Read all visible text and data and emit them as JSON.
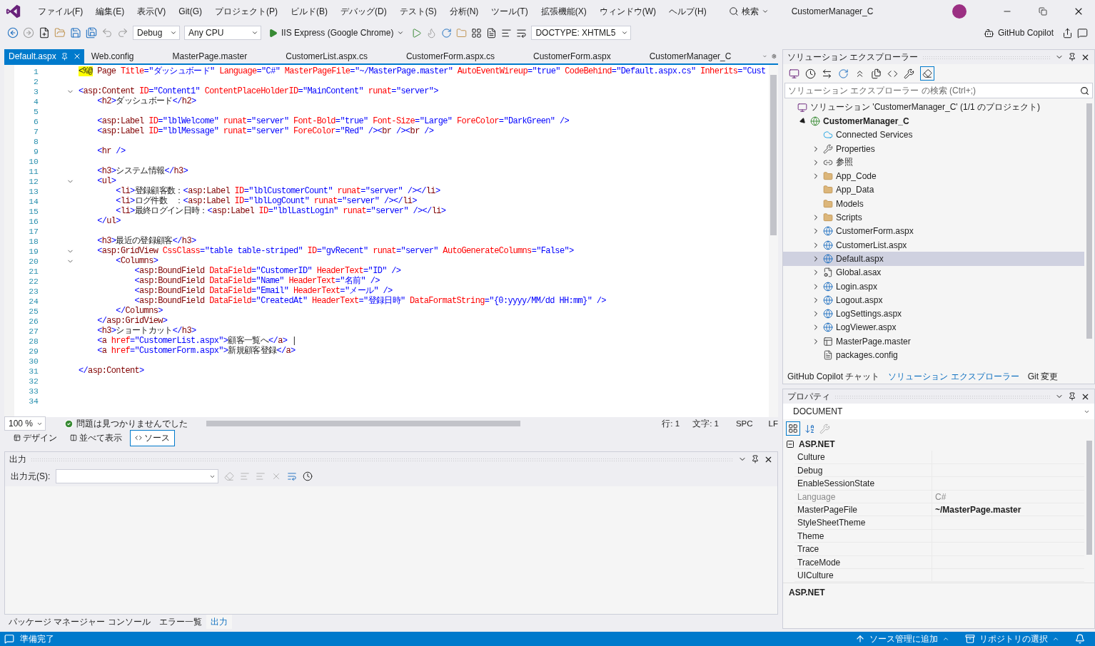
{
  "menu": [
    "ファイル(F)",
    "編集(E)",
    "表示(V)",
    "Git(G)",
    "プロジェクト(P)",
    "ビルド(B)",
    "デバッグ(D)",
    "テスト(S)",
    "分析(N)",
    "ツール(T)",
    "拡張機能(X)",
    "ウィンドウ(W)",
    "ヘルプ(H)"
  ],
  "search": "検索",
  "window_title": "CustomerManager_C",
  "toolbar": {
    "configuration": "Debug",
    "platform": "Any CPU",
    "run_target": "IIS Express (Google Chrome)",
    "doctype": "DOCTYPE: XHTML5",
    "copilot": "GitHub Copilot"
  },
  "editor_tabs": [
    {
      "label": "Default.aspx",
      "selected": true
    },
    {
      "label": "Web.config",
      "selected": false
    },
    {
      "label": "MasterPage.master",
      "selected": false
    },
    {
      "label": "CustomerList.aspx.cs",
      "selected": false
    },
    {
      "label": "CustomerForm.aspx.cs",
      "selected": false
    },
    {
      "label": "CustomerForm.aspx",
      "selected": false
    },
    {
      "label": "CustomerManager_C",
      "selected": false
    }
  ],
  "code_lines": [
    {
      "number": "1",
      "foldable": false,
      "code": "<%@ Page Title=\"ダッシュボード\" Language=\"C#\" MasterPageFile=\"~/MasterPage.master\" AutoEventWireup=\"true\" CodeBehind=\"Default.aspx.cs\" Inherits=\"Cust"
    },
    {
      "number": "2",
      "foldable": false
    },
    {
      "number": "3",
      "foldable": true,
      "code": "<asp:Content ID=\"Content1\" ContentPlaceHolderID=\"MainContent\" runat=\"server\">"
    },
    {
      "number": "4",
      "foldable": false,
      "code": "    <h2>ダッシュボード</h2>"
    },
    {
      "number": "5",
      "foldable": false
    },
    {
      "number": "6",
      "foldable": false,
      "code": "    <asp:Label ID=\"lblWelcome\" runat=\"server\" Font-Bold=\"true\" Font-Size=\"Large\" ForeColor=\"DarkGreen\" />"
    },
    {
      "number": "7",
      "foldable": false,
      "code": "    <asp:Label ID=\"lblMessage\" runat=\"server\" ForeColor=\"Red\" /><br /><br />"
    },
    {
      "number": "8",
      "foldable": false
    },
    {
      "number": "9",
      "foldable": false,
      "code": "    <hr />"
    },
    {
      "number": "10",
      "foldable": false
    },
    {
      "number": "11",
      "foldable": false,
      "code": "    <h3>システム情報</h3>"
    },
    {
      "number": "12",
      "foldable": true,
      "code": "    <ul>"
    },
    {
      "number": "13",
      "foldable": false,
      "code": "        <li>登録顧客数：<asp:Label ID=\"lblCustomerCount\" runat=\"server\" /></li>"
    },
    {
      "number": "14",
      "foldable": false,
      "code": "        <li>ログ件数　：<asp:Label ID=\"lblLogCount\" runat=\"server\" /></li>"
    },
    {
      "number": "15",
      "foldable": false,
      "code": "        <li>最終ログイン日時：<asp:Label ID=\"lblLastLogin\" runat=\"server\" /></li>"
    },
    {
      "number": "16",
      "foldable": false,
      "code": "    </ul>"
    },
    {
      "number": "17",
      "foldable": false
    },
    {
      "number": "18",
      "foldable": false,
      "code": "    <h3>最近の登録顧客</h3>"
    },
    {
      "number": "19",
      "foldable": true,
      "code": "    <asp:GridView CssClass=\"table table-striped\" ID=\"gvRecent\" runat=\"server\" AutoGenerateColumns=\"False\">"
    },
    {
      "number": "20",
      "foldable": true,
      "code": "        <Columns>"
    },
    {
      "number": "21",
      "foldable": false,
      "code": "            <asp:BoundField DataField=\"CustomerID\" HeaderText=\"ID\" />"
    },
    {
      "number": "22",
      "foldable": false,
      "code": "            <asp:BoundField DataField=\"Name\" HeaderText=\"名前\" />"
    },
    {
      "number": "23",
      "foldable": false,
      "code": "            <asp:BoundField DataField=\"Email\" HeaderText=\"メール\" />"
    },
    {
      "number": "24",
      "foldable": false,
      "code": "            <asp:BoundField DataField=\"CreatedAt\" HeaderText=\"登録日時\" DataFormatString=\"{0:yyyy/MM/dd HH:mm}\" />"
    },
    {
      "number": "25",
      "foldable": false,
      "code": "        </Columns>"
    },
    {
      "number": "26",
      "foldable": false,
      "code": "    </asp:GridView>"
    },
    {
      "number": "27",
      "foldable": false,
      "code": "    <h3>ショートカット</h3>"
    },
    {
      "number": "28",
      "foldable": false,
      "code": "    <a href=\"CustomerList.aspx\">顧客一覧へ</a> |"
    },
    {
      "number": "29",
      "foldable": false,
      "code": "    <a href=\"CustomerForm.aspx\">新規顧客登録</a>"
    },
    {
      "number": "30",
      "foldable": false
    },
    {
      "number": "31",
      "foldable": false,
      "code": "</asp:Content>"
    },
    {
      "number": "32",
      "foldable": false
    },
    {
      "number": "33",
      "foldable": false
    },
    {
      "number": "34",
      "foldable": false
    }
  ],
  "editor_status": {
    "zoom": "100 %",
    "issues": "問題は見つかりませんでした",
    "line": "行: 1",
    "column": "文字: 1",
    "whitespace": "SPC",
    "line_ending": "LF"
  },
  "view_tabs": [
    {
      "label": "デザイン",
      "kind": "design",
      "selected": false
    },
    {
      "label": "並べて表示",
      "kind": "split",
      "selected": false
    },
    {
      "label": "ソース",
      "kind": "source",
      "selected": true
    }
  ],
  "output": {
    "title": "出力",
    "source_label": "出力元(S):"
  },
  "bottom_tabs": [
    {
      "label": "パッケージ マネージャー コンソール",
      "selected": false
    },
    {
      "label": "エラー一覧",
      "selected": false
    },
    {
      "label": "出力",
      "selected": true
    }
  ],
  "solution_explorer": {
    "title": "ソリューション エクスプローラー",
    "search_placeholder": "ソリューション エクスプローラー の検索 (Ctrl+;)",
    "tree": [
      {
        "label": "ソリューション 'CustomerManager_C' (1/1 のプロジェクト)",
        "kind": "solution",
        "expandable": false,
        "selected": false,
        "children": [
          {
            "label": "CustomerManager_C",
            "kind": "project",
            "expandable": true,
            "expanded": true,
            "selected": false,
            "children": [
              {
                "label": "Connected Services",
                "kind": "cloud",
                "expandable": false,
                "selected": false
              },
              {
                "label": "Properties",
                "kind": "wrench",
                "expandable": true,
                "expanded": false,
                "selected": false
              },
              {
                "label": "参照",
                "kind": "references",
                "expandable": true,
                "expanded": false,
                "selected": false
              },
              {
                "label": "App_Code",
                "kind": "folder",
                "expandable": true,
                "expanded": false,
                "selected": false
              },
              {
                "label": "App_Data",
                "kind": "folder",
                "expandable": false,
                "selected": false
              },
              {
                "label": "Models",
                "kind": "folder",
                "expandable": false,
                "selected": false
              },
              {
                "label": "Scripts",
                "kind": "folder",
                "expandable": true,
                "expanded": false,
                "selected": false
              },
              {
                "label": "CustomerForm.aspx",
                "kind": "page",
                "expandable": true,
                "expanded": false,
                "selected": false
              },
              {
                "label": "CustomerList.aspx",
                "kind": "page",
                "expandable": true,
                "expanded": false,
                "selected": false
              },
              {
                "label": "Default.aspx",
                "kind": "page",
                "expandable": true,
                "expanded": false,
                "selected": true
              },
              {
                "label": "Global.asax",
                "kind": "file",
                "expandable": true,
                "expanded": false,
                "selected": false
              },
              {
                "label": "Login.aspx",
                "kind": "page",
                "expandable": true,
                "expanded": false,
                "selected": false
              },
              {
                "label": "Logout.aspx",
                "kind": "page",
                "expandable": true,
                "expanded": false,
                "selected": false
              },
              {
                "label": "LogSettings.aspx",
                "kind": "page",
                "expandable": true,
                "expanded": false,
                "selected": false
              },
              {
                "label": "LogViewer.aspx",
                "kind": "page",
                "expandable": true,
                "expanded": false,
                "selected": false
              },
              {
                "label": "MasterPage.master",
                "kind": "master",
                "expandable": true,
                "expanded": false,
                "selected": false
              },
              {
                "label": "packages.config",
                "kind": "config",
                "expandable": false,
                "selected": false
              }
            ]
          }
        ]
      }
    ]
  },
  "panel_tabs": [
    {
      "label": "GitHub Copilot チャット",
      "selected": false
    },
    {
      "label": "ソリューション エクスプローラー",
      "selected": true
    },
    {
      "label": "Git 変更",
      "selected": false
    }
  ],
  "properties": {
    "title": "プロパティ",
    "object": "DOCUMENT",
    "category": "ASP.NET",
    "rows": [
      {
        "name": "Culture",
        "disabled": false
      },
      {
        "name": "Debug",
        "disabled": false
      },
      {
        "name": "EnableSessionState",
        "disabled": false
      },
      {
        "name": "Language",
        "value": "C#",
        "disabled": true,
        "modified": false
      },
      {
        "name": "MasterPageFile",
        "value": "~/MasterPage.master",
        "disabled": false,
        "modified": true
      },
      {
        "name": "StyleSheetTheme",
        "disabled": false
      },
      {
        "name": "Theme",
        "disabled": false
      },
      {
        "name": "Trace",
        "disabled": false
      },
      {
        "name": "TraceMode",
        "disabled": false
      },
      {
        "name": "UICulture",
        "disabled": false
      }
    ],
    "description": "ASP.NET"
  },
  "status_bar": {
    "message": "準備完了",
    "source_control": "ソース管理に追加",
    "repository": "リポジトリの選択"
  }
}
